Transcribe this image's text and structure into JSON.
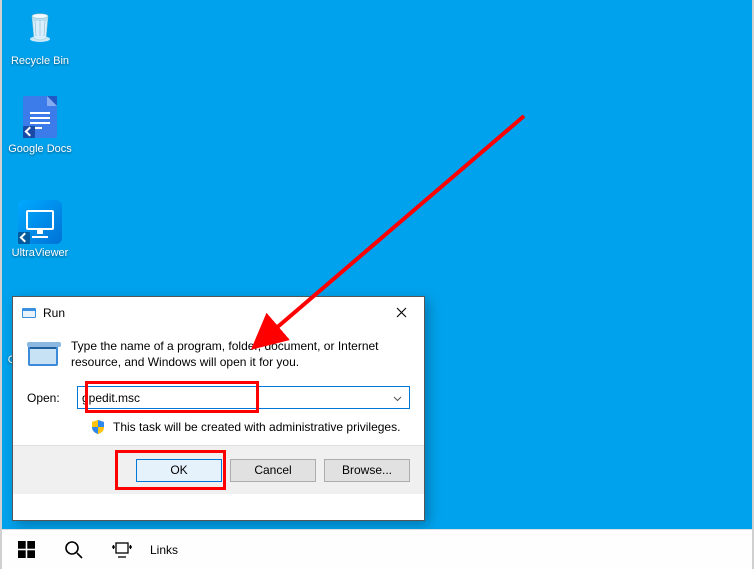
{
  "desktop": {
    "icons": [
      {
        "label": "Recycle Bin"
      },
      {
        "label": "Google Docs"
      },
      {
        "label": "UltraViewer"
      },
      {
        "label": "G"
      }
    ]
  },
  "run": {
    "title": "Run",
    "description": "Type the name of a program, folder, document, or Internet resource, and Windows will open it for you.",
    "open_label": "Open:",
    "input_value": "gpedit.msc",
    "admin_note": "This task will be created with administrative privileges.",
    "buttons": {
      "ok": "OK",
      "cancel": "Cancel",
      "browse": "Browse..."
    }
  },
  "taskbar": {
    "links_label": "Links"
  },
  "annotation": {
    "color": "#ff0000"
  }
}
